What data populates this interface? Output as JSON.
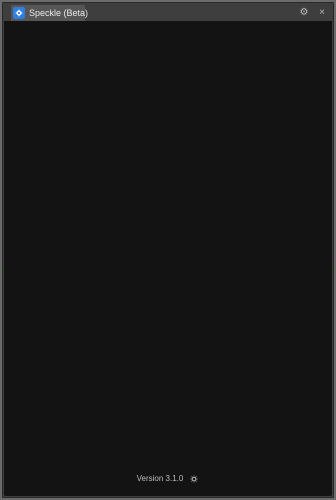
{
  "window": {
    "tab_title": "Speckle (Beta)"
  },
  "icons": {
    "app": "speckle-logo-icon",
    "window_settings": "gear-icon",
    "close": "close-icon",
    "footer_settings": "settings-icon"
  },
  "colors": {
    "backdrop": "#6b6b6b",
    "window_frame": "#3d3d3d",
    "tab_active": "#565656",
    "content_background": "#131313",
    "brand": "#2f7fe0",
    "text": "#bdbdbd"
  },
  "footer": {
    "version_label": "Version 3.1.0"
  }
}
